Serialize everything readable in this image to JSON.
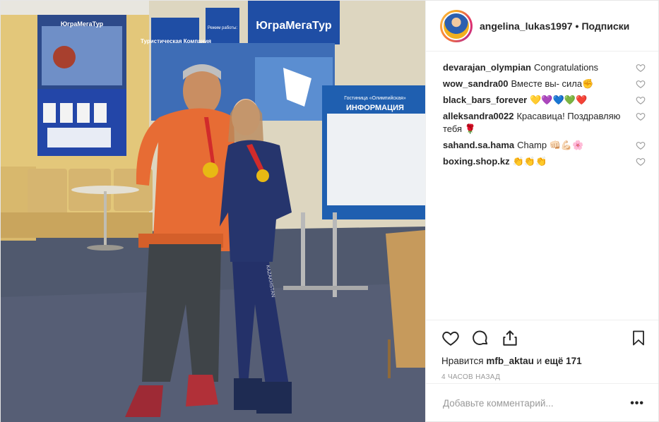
{
  "post": {
    "username": "angelina_lukas1997",
    "separator": "•",
    "follow_label": "Подписки",
    "photo_signs": {
      "tour": "ЮграМегаТур",
      "tourist_company": "Туристическая Компания",
      "info": "ИНФОРМАЦИЯ",
      "hotel": "Гостиница «Олимпийская»",
      "hours": "Режим работы:",
      "jacket_text": "KAZAKHSTAN"
    }
  },
  "comments": [
    {
      "user": "devarajan_olympian",
      "text": "Congratulations",
      "emoji": ""
    },
    {
      "user": "wow_sandra00",
      "text": "Вместе вы- сила",
      "emoji": "✊"
    },
    {
      "user": "black_bars_forever",
      "text": "",
      "emoji": "💛💜💙💚❤️"
    },
    {
      "user": "alleksandra0022",
      "text": "Красавица! Поздравляю тебя",
      "emoji": "🌹"
    },
    {
      "user": "sahand.sa.hama",
      "text": "Champ",
      "emoji": "👊🏻💪🏻🌸"
    },
    {
      "user": "boxing.shop.kz",
      "text": "",
      "emoji": "👏👏👏"
    }
  ],
  "likes": {
    "prefix": "Нравится",
    "user": "mfb_aktau",
    "mid": "и",
    "rest": "ещё 171"
  },
  "time_ago": "4 часов назад",
  "add_comment_placeholder": "Добавьте комментарий...",
  "more_label": "•••",
  "colors": {
    "accent": "#262626",
    "muted": "#999999",
    "border": "#efefef"
  }
}
